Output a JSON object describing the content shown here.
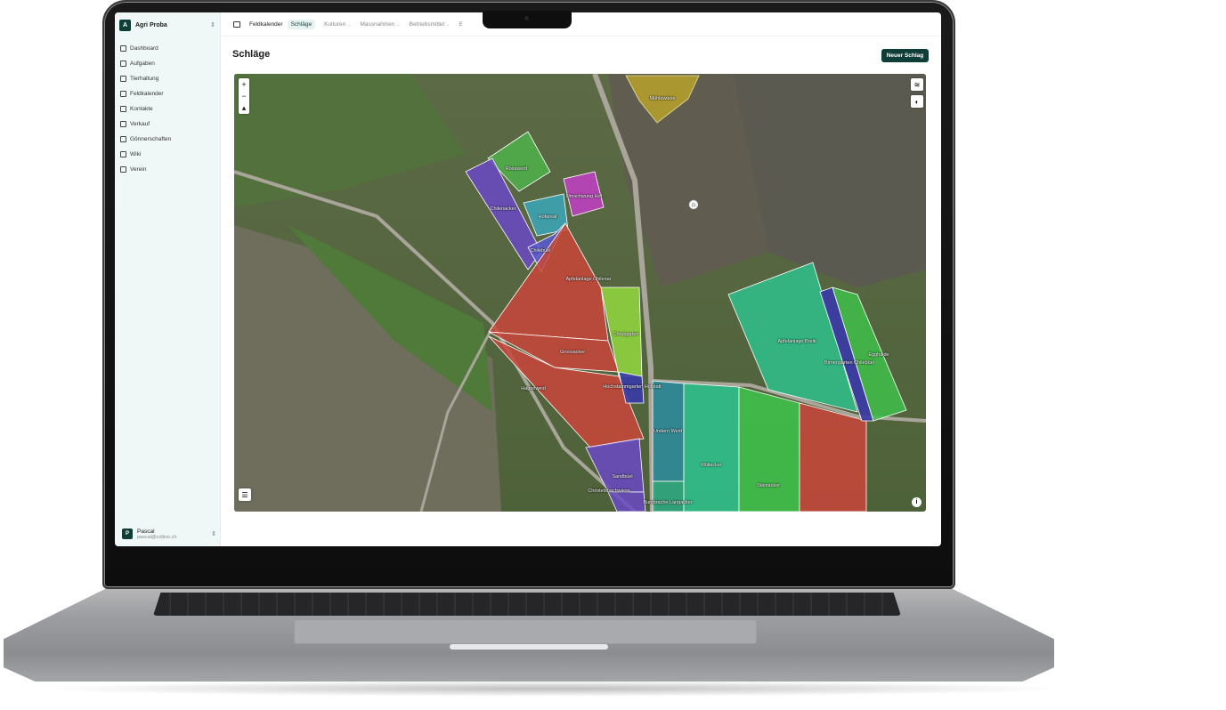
{
  "org": {
    "badge": "A",
    "name": "Agri Proba",
    "chevron": "⇕"
  },
  "sidebar": {
    "items": [
      {
        "label": "Dashboard",
        "icon": "dashboard-icon"
      },
      {
        "label": "Aufgaben",
        "icon": "tasks-icon"
      },
      {
        "label": "Tierhaltung",
        "icon": "livestock-icon"
      },
      {
        "label": "Feldkalender",
        "icon": "field-calendar-icon"
      },
      {
        "label": "Kontakte",
        "icon": "contacts-icon"
      },
      {
        "label": "Verkauf",
        "icon": "cart-icon"
      },
      {
        "label": "Gönnerschaften",
        "icon": "heart-icon"
      },
      {
        "label": "Wiki",
        "icon": "book-icon"
      },
      {
        "label": "Verein",
        "icon": "group-icon"
      }
    ]
  },
  "user": {
    "badge": "P",
    "name": "Pascal",
    "email": "pascal@coltivo.ch",
    "chevron": "⇕"
  },
  "topbar": {
    "crumb": "Feldkalender",
    "tabs": [
      {
        "label": "Schläge",
        "active": true
      },
      {
        "label": "Kulturen",
        "chevron": "⌄"
      },
      {
        "label": "Massnahmen",
        "chevron": "⌄"
      },
      {
        "label": "Betriebsmittel",
        "chevron": "⌄"
      },
      {
        "label": "E"
      }
    ]
  },
  "page": {
    "title": "Schläge",
    "new_button": "Neuer Schlag"
  },
  "map": {
    "zoom_in": "+",
    "zoom_out": "−",
    "compass": "▴",
    "layers_glyph": "≋",
    "palette_glyph": "◐",
    "legend_glyph": "☰",
    "info_glyph": "i",
    "home_glyph": "⌂",
    "fields": [
      {
        "name": "Mühlewiese",
        "color": "#b8a12a"
      },
      {
        "name": "Rosswerd",
        "color": "#4fb34a"
      },
      {
        "name": "Umschwung Hof",
        "color": "#c23fc6"
      },
      {
        "name": "Chilenacker",
        "color": "#6a49c4"
      },
      {
        "name": "Hofareal",
        "color": "#3aa7b8"
      },
      {
        "name": "Chilebüel",
        "color": "#5b5bd2"
      },
      {
        "name": "Apfelanlage Chilenar",
        "color": "#c9453a"
      },
      {
        "name": "Grossacker",
        "color": "#c9453a"
      },
      {
        "name": "Chrutgarten",
        "color": "#8fd13e"
      },
      {
        "name": "Hagenweid",
        "color": "#c9453a"
      },
      {
        "name": "Hochstammgarten Hofstatt",
        "color": "#3a3aa8"
      },
      {
        "name": "Sandbüel",
        "color": "#6a49c4"
      },
      {
        "name": "Christelsbachwiese",
        "color": "#6a49c4"
      },
      {
        "name": "Undern Weid",
        "color": "#2f8a9a"
      },
      {
        "name": "Buntbrache Langacker",
        "color": "#2fa77f"
      },
      {
        "name": "Müliacker",
        "color": "#2fbf8c"
      },
      {
        "name": "Steinacker",
        "color": "#3fbf4a"
      },
      {
        "name": "Apfelanlage Breiti",
        "color": "#2fbf8c"
      },
      {
        "name": "Birnengarten Chilebüel",
        "color": "#3a3aa8"
      },
      {
        "name": "Egghalde",
        "color": "#3fbf4a"
      }
    ]
  }
}
